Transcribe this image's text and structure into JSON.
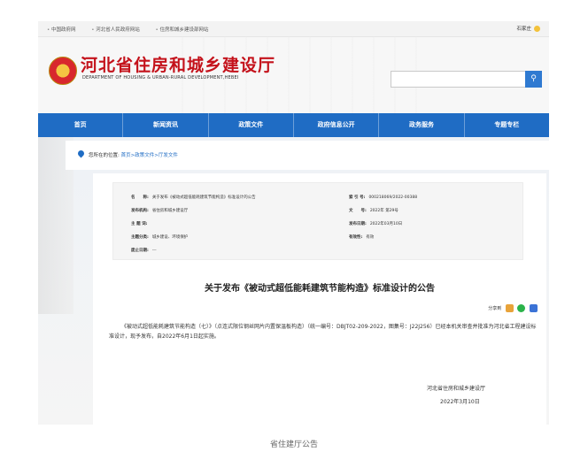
{
  "topbar": {
    "links": [
      "中国政府网",
      "河北省人民政府网站",
      "住房和城乡建设部网站"
    ],
    "city": "石家庄"
  },
  "header": {
    "title": "河北省住房和城乡建设厅",
    "subtitle": "DEPARTMENT OF HOUSING & URBAN-RURAL DEVELOPMENT,HEBEI"
  },
  "nav": [
    "首页",
    "新闻资讯",
    "政策文件",
    "政府信息公开",
    "政务服务",
    "专题专栏"
  ],
  "breadcrumb": {
    "prefix": "您所在的位置:",
    "path": "首页>政策文件>厅发文件"
  },
  "info": {
    "name_label": "名　　称:",
    "name_value": "关于发布《被动式超低能耗建筑节能构造》标准设计的公告",
    "index_label": "索 引 号:",
    "index_value": "000218069/2022-00388",
    "publisher_label": "发布机构:",
    "publisher_value": "省住房和城乡建设厅",
    "docno_label": "文　　号:",
    "docno_value": "2022年 第29号",
    "subject_label": "主 题 词:",
    "subject_value": "",
    "date_label": "发布日期:",
    "date_value": "2022年03月10日",
    "category_label": "主题分类:",
    "category_value": "城乡建设、环境保护",
    "validity_label": "有效性:",
    "validity_value": "有效",
    "repeal_label": "废止日期:",
    "repeal_value": "---"
  },
  "article": {
    "title": "关于发布《被动式超低能耗建筑节能构造》标准设计的公告",
    "share_label": "分享到",
    "body": "《被动式超低能耗建筑节能构造（七）》（点连式限位钢丝网片内置保温板构造）（统一编号：DBJT02-209-2022，图集号：J22J256）已经本机关审查并批准为河北省工程建设标准设计，现予发布，自2022年6月1日起实施。",
    "signature": "河北省住房和城乡建设厅",
    "date": "2022年3月10日"
  },
  "caption": "省住建厅公告"
}
